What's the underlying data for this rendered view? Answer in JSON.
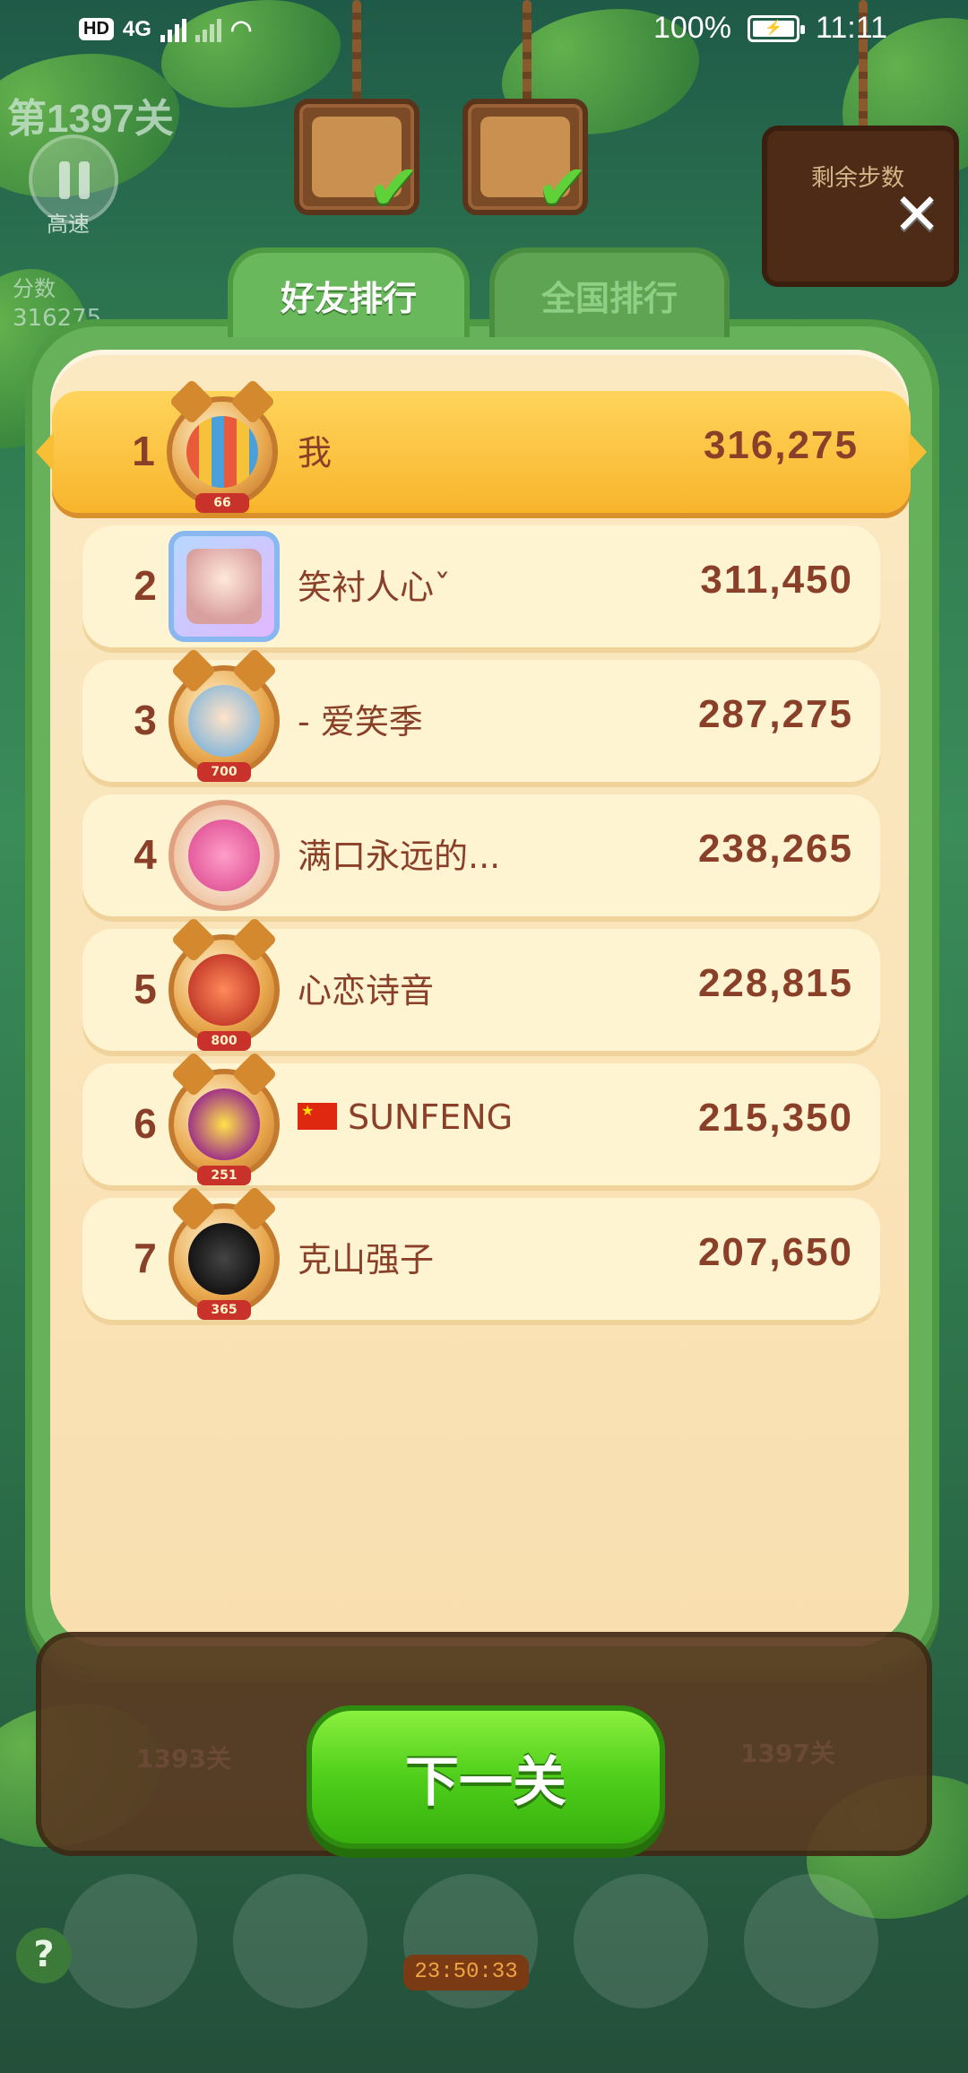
{
  "status_bar": {
    "network": "4G",
    "battery": "100%",
    "time": "11:11"
  },
  "hud": {
    "level": "第1397关",
    "speed_label": "高速",
    "score_label": "分数",
    "score_value": "316275",
    "steps_label": "剩余步数"
  },
  "tabs": [
    {
      "label": "好友排行",
      "active": true
    },
    {
      "label": "全国排行",
      "active": false
    }
  ],
  "leaderboard": [
    {
      "rank": "1",
      "name": "我",
      "score": "316,275",
      "badge": "66",
      "is_me": true
    },
    {
      "rank": "2",
      "name": "笑衬人心ˇ",
      "score": "311,450",
      "badge": ""
    },
    {
      "rank": "3",
      "name": "- 爱笑季",
      "score": "287,275",
      "badge": "700"
    },
    {
      "rank": "4",
      "name": "满口永远的...",
      "score": "238,265",
      "badge": ""
    },
    {
      "rank": "5",
      "name": "心恋诗音",
      "score": "228,815",
      "badge": "800"
    },
    {
      "rank": "6",
      "name": "SUNFENG",
      "score": "215,350",
      "badge": "251",
      "flag": "cn-flag"
    },
    {
      "rank": "7",
      "name": "克山强子",
      "score": "207,650",
      "badge": "365"
    }
  ],
  "progress": {
    "left_level": "1393关",
    "right_level": "1397关"
  },
  "next_button": "下一关",
  "timer": "23:50:33",
  "help": "?"
}
